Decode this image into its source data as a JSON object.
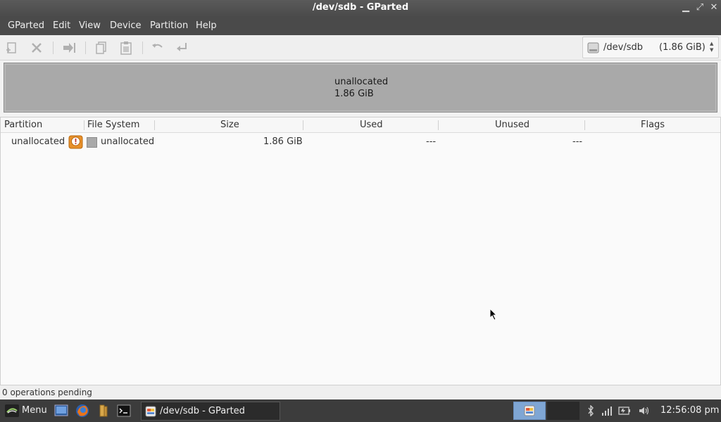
{
  "window": {
    "title": "/dev/sdb - GParted"
  },
  "menubar": {
    "items": [
      "GParted",
      "Edit",
      "View",
      "Device",
      "Partition",
      "Help"
    ]
  },
  "toolbar": {
    "buttons": [
      "new-partition",
      "delete-partition",
      "resize-move",
      "copy",
      "paste",
      "undo",
      "apply"
    ],
    "device": {
      "name": "/dev/sdb",
      "size": "(1.86 GiB)"
    }
  },
  "diskmap": {
    "label": "unallocated",
    "size": "1.86 GiB"
  },
  "table": {
    "columns": [
      "Partition",
      "File System",
      "Size",
      "Used",
      "Unused",
      "Flags"
    ],
    "rows": [
      {
        "partition": "unallocated",
        "file_system": "unallocated",
        "size": "1.86 GiB",
        "used": "---",
        "unused": "---",
        "flags": ""
      }
    ]
  },
  "statusbar": {
    "text": "0 operations pending"
  },
  "taskbar": {
    "menu_label": "Menu",
    "task_label": "/dev/sdb - GParted",
    "clock": "12:56:08 pm"
  },
  "colors": {
    "unallocated": "#a9a9a9",
    "titlebar": "#4a4a4a",
    "taskbar": "#3c3c3c",
    "pager_active": "#7fa6d4"
  }
}
